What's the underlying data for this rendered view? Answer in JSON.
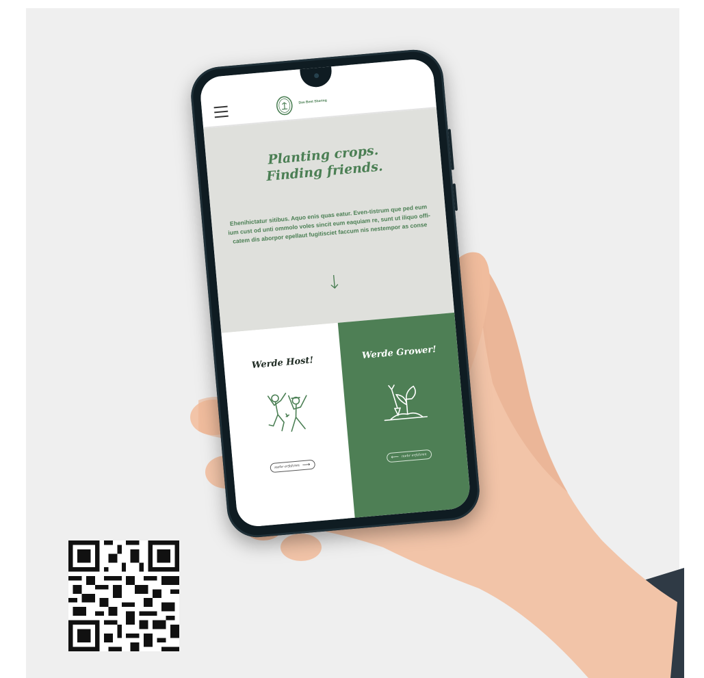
{
  "app": {
    "brand_name": "Das Beet Sharing",
    "logo_icon": "garden-badge-icon",
    "menu_icon": "hamburger-menu-icon"
  },
  "hero": {
    "title_line1": "Planting crops.",
    "title_line2": "Finding friends.",
    "body": "Ehenihictatur sitibus. Aquo enis quas eatur. Even-tistrum que ped eum ium cust od unti ommolo voles sincit eum eaquiam re, sunt ut iliquo offi-catem dis aborpor epellaut fugitisciet faccum nis nestempor as conse",
    "arrow_icon": "arrow-down-icon"
  },
  "cards": {
    "host": {
      "title": "Werde Host!",
      "illustration": "two-jumping-people-icon",
      "button_label": "mehr erfahren",
      "button_arrow": "⟶"
    },
    "grower": {
      "title": "Werde Grower!",
      "illustration": "shovel-and-plant-icon",
      "button_label": "mehr erfahren",
      "button_arrow": "⟵"
    }
  },
  "colors": {
    "brand_green": "#4e7f55",
    "hero_bg": "#dfe0dc",
    "backdrop": "#efefef"
  }
}
